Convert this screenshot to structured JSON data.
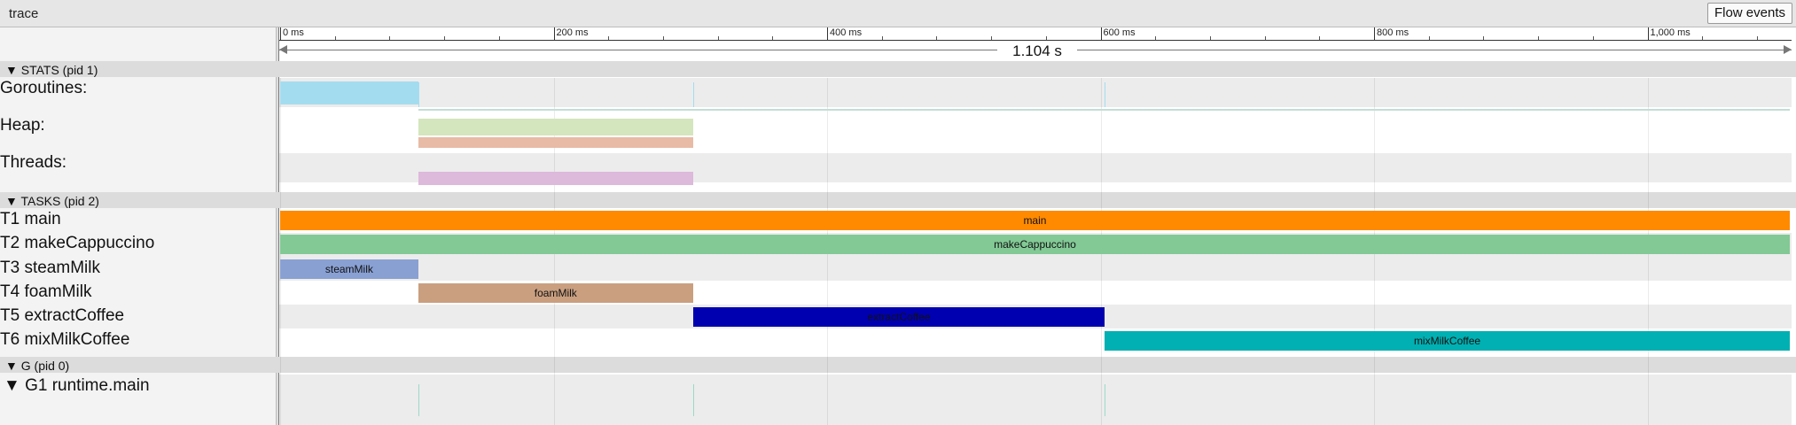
{
  "app": {
    "title": "trace",
    "flow_events_label": "Flow events"
  },
  "ruler": {
    "span_label": "1.104 s",
    "ticks": [
      {
        "label": "0 ms",
        "t": 0
      },
      {
        "label": "200 ms",
        "t": 200
      },
      {
        "label": "400 ms",
        "t": 400
      },
      {
        "label": "600 ms",
        "t": 600
      },
      {
        "label": "800 ms",
        "t": 800
      },
      {
        "label": "1,000 ms",
        "t": 1000
      }
    ]
  },
  "sections": {
    "stats": "▼ STATS (pid 1)",
    "tasks": "▼ TASKS (pid 2)",
    "g": "▼ G (pid 0)"
  },
  "stats_rows": {
    "goroutines": "Goroutines:",
    "heap": "Heap:",
    "threads": "Threads:"
  },
  "counters": {
    "goroutines": {
      "color": "#a4dcef",
      "segments": [
        {
          "start": 0,
          "end": 101
        }
      ]
    },
    "heap": [
      {
        "color": "#d4e6bd",
        "segments": [
          {
            "start": 101,
            "end": 302
          }
        ]
      },
      {
        "color": "#e8bba6",
        "segments": [
          {
            "start": 101,
            "end": 302
          }
        ]
      }
    ],
    "threads": {
      "color": "#ddb9db",
      "segments": [
        {
          "start": 101,
          "end": 302
        }
      ]
    }
  },
  "tasks": [
    {
      "row_label": "T1 main",
      "slice_label": "main",
      "start": 0,
      "end": 1104,
      "color": "#ff8a00"
    },
    {
      "row_label": "T2 makeCappuccino",
      "slice_label": "makeCappuccino",
      "start": 0,
      "end": 1104,
      "color": "#82c995"
    },
    {
      "row_label": "T3 steamMilk",
      "slice_label": "steamMilk",
      "start": 0,
      "end": 101,
      "color": "#89a0d3"
    },
    {
      "row_label": "T4 foamMilk",
      "slice_label": "foamMilk",
      "start": 101,
      "end": 302,
      "color": "#c99f80"
    },
    {
      "row_label": "T5 extractCoffee",
      "slice_label": "extractCoffee",
      "start": 302,
      "end": 603,
      "color": "#0000b0"
    },
    {
      "row_label": "T6 mixMilkCoffee",
      "slice_label": "mixMilkCoffee",
      "start": 603,
      "end": 1104,
      "color": "#00b0b2"
    }
  ],
  "goroutine_rows": [
    {
      "row_label": "▼  G1 runtime.main"
    }
  ],
  "markers": [
    101,
    302,
    603
  ]
}
